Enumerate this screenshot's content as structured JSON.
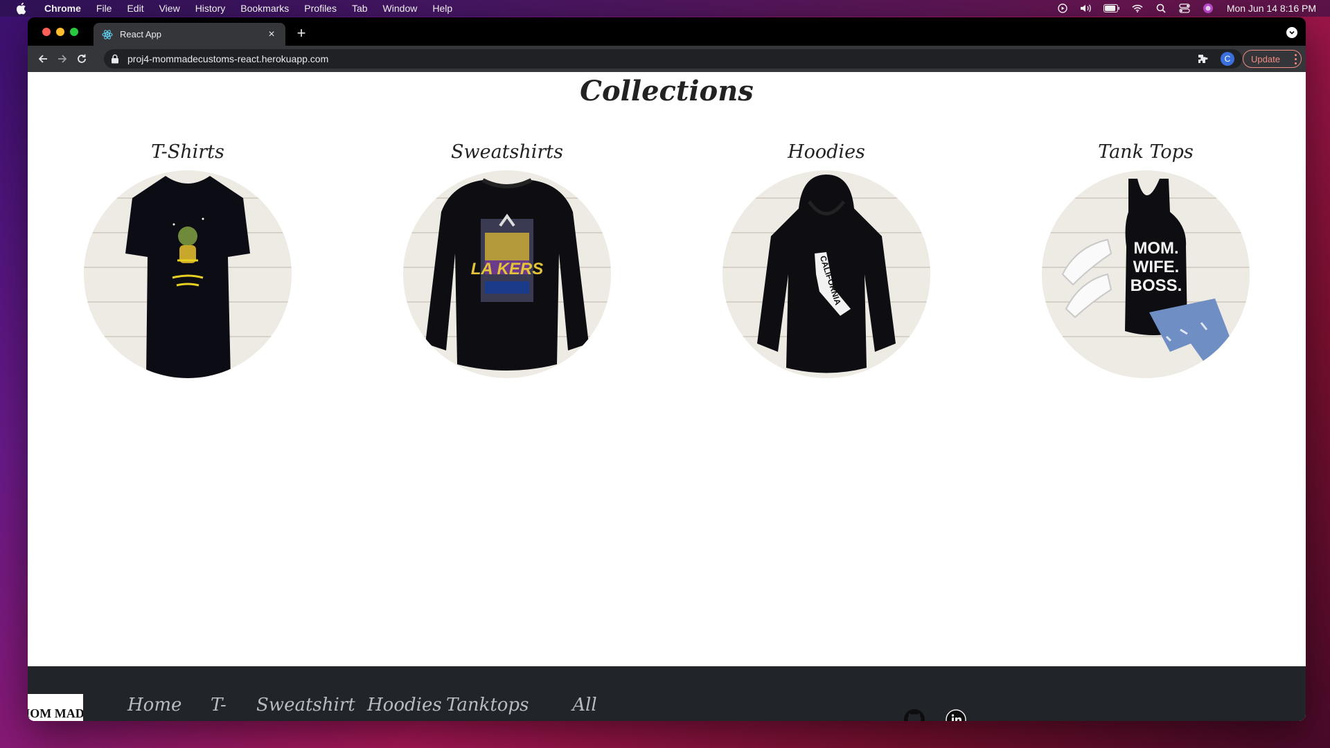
{
  "menubar": {
    "app_name": "Chrome",
    "menus": [
      "File",
      "Edit",
      "View",
      "History",
      "Bookmarks",
      "Profiles",
      "Tab",
      "Window",
      "Help"
    ],
    "clock": "Mon Jun 14  8:16 PM"
  },
  "browser": {
    "tab_title": "React App",
    "url": "proj4-mommadecustoms-react.herokuapp.com",
    "profile_initial": "C",
    "update_label": "Update"
  },
  "page": {
    "title": "Collections",
    "collections": [
      {
        "label": "T-Shirts"
      },
      {
        "label": "Sweatshirts"
      },
      {
        "label": "Hoodies"
      },
      {
        "label": "Tank Tops"
      }
    ],
    "product_text": {
      "tank_top": [
        "MOM.",
        "WIFE.",
        "BOSS."
      ],
      "sweatshirt": "LA KERS",
      "hoodie": "CALIFORNIA"
    },
    "footer": {
      "logo_text": "MOM MADE",
      "nav": [
        "Home",
        "T-Shirts",
        "Sweatshirts",
        "Hoodies",
        "Tanktops",
        "All Products"
      ]
    }
  },
  "colors": {
    "accent_update": "#f28b82",
    "footer_bg": "#212529",
    "page_bg": "#ffffff"
  }
}
